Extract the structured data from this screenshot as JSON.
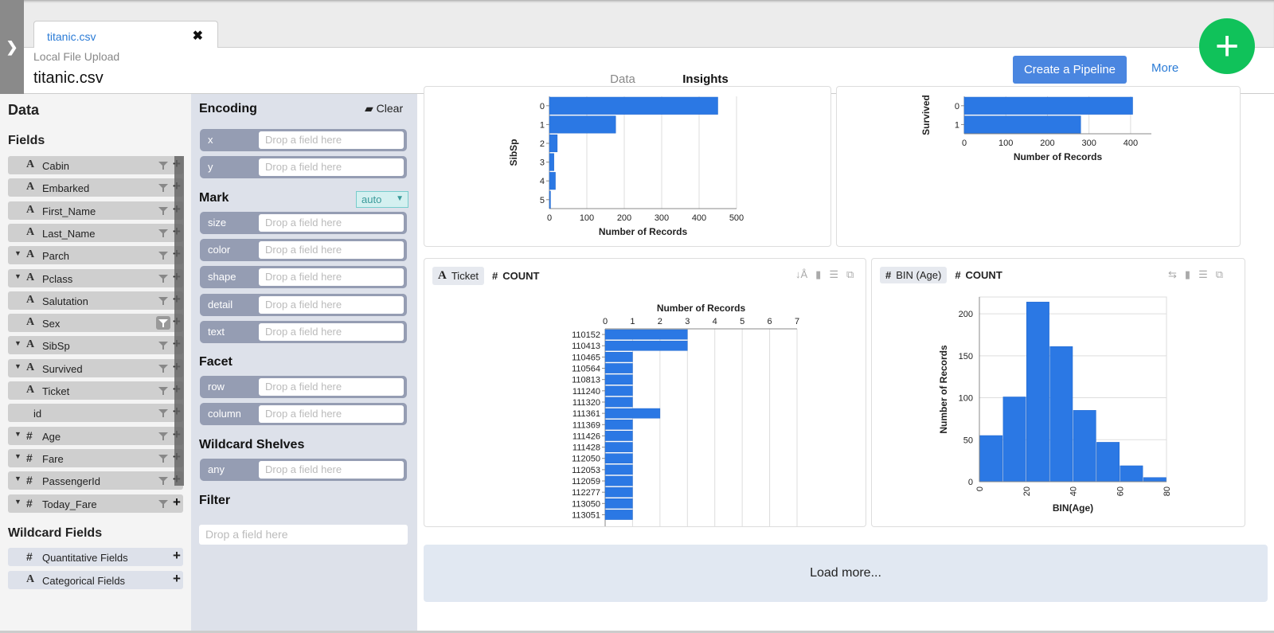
{
  "file_tab": {
    "name": "titanic.csv",
    "close_icon": "close-icon"
  },
  "header": {
    "source": "Local File Upload",
    "title": "titanic.csv",
    "tabs": [
      {
        "label": "Data",
        "active": false
      },
      {
        "label": "Insights",
        "active": true
      }
    ],
    "pipeline_button": "Create a Pipeline",
    "more_link": "More",
    "fab_icon": "+"
  },
  "data_pane": {
    "title": "Data",
    "fields_heading": "Fields",
    "fields": [
      {
        "name": "Cabin",
        "type": "A",
        "expandable": false,
        "filter_active": false
      },
      {
        "name": "Embarked",
        "type": "A",
        "expandable": false,
        "filter_active": false
      },
      {
        "name": "First_Name",
        "type": "A",
        "expandable": false,
        "filter_active": false
      },
      {
        "name": "Last_Name",
        "type": "A",
        "expandable": false,
        "filter_active": false
      },
      {
        "name": "Parch",
        "type": "A",
        "expandable": true,
        "filter_active": false
      },
      {
        "name": "Pclass",
        "type": "A",
        "expandable": true,
        "filter_active": false
      },
      {
        "name": "Salutation",
        "type": "A",
        "expandable": false,
        "filter_active": false
      },
      {
        "name": "Sex",
        "type": "A",
        "expandable": false,
        "filter_active": true
      },
      {
        "name": "SibSp",
        "type": "A",
        "expandable": true,
        "filter_active": false
      },
      {
        "name": "Survived",
        "type": "A",
        "expandable": true,
        "filter_active": false
      },
      {
        "name": "Ticket",
        "type": "A",
        "expandable": false,
        "filter_active": false
      },
      {
        "name": "id",
        "type": "",
        "expandable": false,
        "filter_active": false
      },
      {
        "name": "Age",
        "type": "#",
        "expandable": true,
        "filter_active": false
      },
      {
        "name": "Fare",
        "type": "#",
        "expandable": true,
        "filter_active": false
      },
      {
        "name": "PassengerId",
        "type": "#",
        "expandable": true,
        "filter_active": false
      },
      {
        "name": "Today_Fare",
        "type": "#",
        "expandable": true,
        "filter_active": false
      }
    ],
    "wildcard_heading": "Wildcard Fields",
    "wildcard_fields": [
      {
        "name": "Quantitative Fields",
        "type": "#"
      },
      {
        "name": "Categorical Fields",
        "type": "A"
      }
    ]
  },
  "encoding_pane": {
    "title": "Encoding",
    "clear_label": "Clear",
    "placeholder": "Drop a field here",
    "encoding_channels": [
      "x",
      "y"
    ],
    "mark_heading": "Mark",
    "mark_value": "auto",
    "mark_channels": [
      "size",
      "color",
      "shape",
      "detail",
      "text"
    ],
    "facet_heading": "Facet",
    "facet_channels": [
      "row",
      "column"
    ],
    "wildcard_heading": "Wildcard Shelves",
    "wildcard_channels": [
      "any"
    ],
    "filter_heading": "Filter",
    "filter_placeholder": "Drop a field here"
  },
  "load_more": "Load more...",
  "chart_data": [
    {
      "type": "bar",
      "orientation": "horizontal",
      "categories": [
        "0",
        "1",
        "2",
        "3",
        "4",
        "5"
      ],
      "values": [
        450,
        177,
        21,
        12,
        16,
        3
      ],
      "ylabel": "SibSp",
      "xlabel": "Number of Records",
      "xticks": [
        0,
        100,
        200,
        300,
        400,
        500
      ],
      "xlim": [
        0,
        500
      ],
      "partially_visible": true
    },
    {
      "type": "bar",
      "orientation": "horizontal",
      "categories": [
        "0",
        "1"
      ],
      "values": [
        405,
        280
      ],
      "ylabel": "Survived",
      "xlabel": "Number of Records",
      "xticks": [
        0,
        100,
        200,
        300,
        400
      ],
      "xlim": [
        0,
        450
      ],
      "partially_visible": true
    },
    {
      "type": "bar",
      "orientation": "horizontal",
      "header": {
        "field": "Ticket",
        "field_type": "A",
        "measure": "COUNT",
        "measure_type": "#"
      },
      "categories": [
        "110152",
        "110413",
        "110465",
        "110564",
        "110813",
        "111240",
        "111320",
        "111361",
        "111369",
        "111426",
        "111428",
        "112050",
        "112053",
        "112059",
        "112277",
        "113050",
        "113051"
      ],
      "values": [
        3,
        3,
        1,
        1,
        1,
        1,
        1,
        2,
        1,
        1,
        1,
        1,
        1,
        1,
        1,
        1,
        1
      ],
      "title": "Number of Records",
      "xticks": [
        0,
        1,
        2,
        3,
        4,
        5,
        6,
        7
      ],
      "xlim": [
        0,
        7
      ],
      "xaxis_position": "top"
    },
    {
      "type": "bar",
      "subtype": "histogram",
      "header": {
        "field": "BIN (Age)",
        "field_type": "#",
        "measure": "COUNT",
        "measure_type": "#"
      },
      "bins": [
        [
          0,
          10
        ],
        [
          10,
          20
        ],
        [
          20,
          30
        ],
        [
          30,
          40
        ],
        [
          40,
          50
        ],
        [
          50,
          60
        ],
        [
          60,
          70
        ],
        [
          70,
          80
        ]
      ],
      "values": [
        55,
        101,
        214,
        161,
        85,
        47,
        19,
        5
      ],
      "xlabel": "BIN(Age)",
      "ylabel": "Number of Records",
      "xticks": [
        0,
        20,
        40,
        60,
        80
      ],
      "yticks": [
        0,
        50,
        100,
        150,
        200
      ],
      "ylim": [
        0,
        220
      ],
      "xlim": [
        0,
        80
      ]
    }
  ]
}
